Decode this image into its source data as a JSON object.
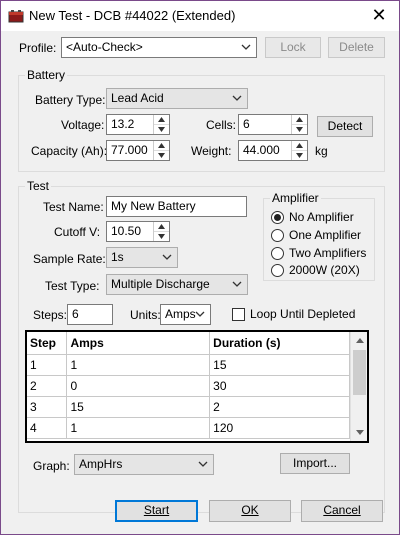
{
  "window": {
    "title": "New Test - DCB #44022 (Extended)"
  },
  "profile": {
    "label": "Profile:",
    "value": "<Auto-Check>",
    "lock_label": "Lock",
    "delete_label": "Delete"
  },
  "battery": {
    "group_label": "Battery",
    "type_label": "Battery Type:",
    "type_value": "Lead Acid",
    "voltage_label": "Voltage:",
    "voltage_value": "13.2",
    "cells_label": "Cells:",
    "cells_value": "6",
    "detect_label": "Detect",
    "capacity_label": "Capacity (Ah):",
    "capacity_value": "77.000",
    "weight_label": "Weight:",
    "weight_value": "44.000",
    "weight_unit": "kg"
  },
  "test": {
    "group_label": "Test",
    "name_label": "Test Name:",
    "name_value": "My New Battery",
    "cutoff_label": "Cutoff V:",
    "cutoff_value": "10.50",
    "sample_label": "Sample Rate:",
    "sample_value": "1s",
    "type_label": "Test Type:",
    "type_value": "Multiple Discharge",
    "steps_label": "Steps:",
    "steps_value": "6",
    "units_label": "Units:",
    "units_value": "Amps",
    "loop_label": "Loop Until Depleted"
  },
  "amplifier": {
    "group_label": "Amplifier",
    "options": [
      "No Amplifier",
      "One Amplifier",
      "Two Amplifiers",
      "2000W (20X)"
    ],
    "selected": "No Amplifier"
  },
  "grid": {
    "headers": [
      "Step",
      "Amps",
      "Duration (s)"
    ],
    "rows": [
      [
        "1",
        "1",
        "15"
      ],
      [
        "2",
        "0",
        "30"
      ],
      [
        "3",
        "15",
        "2"
      ],
      [
        "4",
        "1",
        "120"
      ]
    ]
  },
  "graph": {
    "label": "Graph:",
    "value": "AmpHrs",
    "import_label": "Import..."
  },
  "footer": {
    "start_label": "Start",
    "ok_label": "OK",
    "cancel_label": "Cancel"
  },
  "colors": {
    "accent": "#0078d7",
    "window_border": "#7a4a8a"
  }
}
